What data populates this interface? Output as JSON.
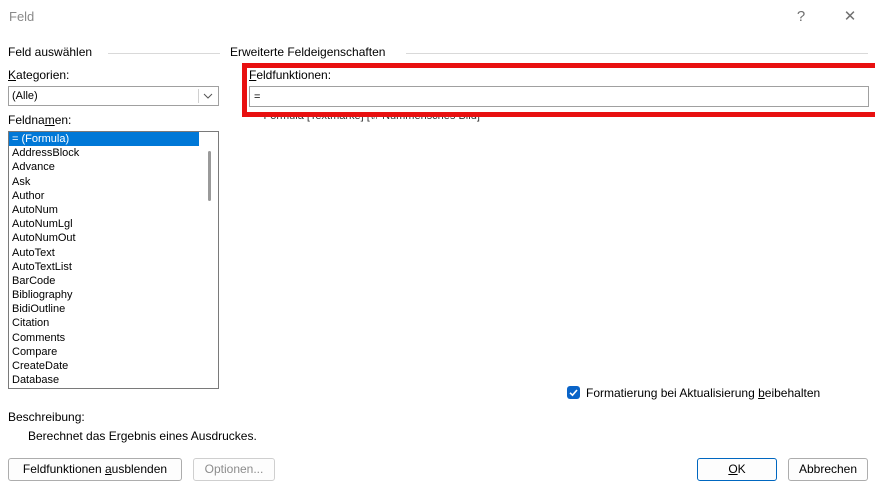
{
  "window": {
    "title": "Feld",
    "help_glyph": "?",
    "close_glyph": "✕"
  },
  "left": {
    "group_header": "Feld auswählen",
    "categories_label": "Kategorien:",
    "categories_value": "(Alle)",
    "fieldnames_label": "Feldnamen:",
    "fieldnames": [
      "= (Formula)",
      "AddressBlock",
      "Advance",
      "Ask",
      "Author",
      "AutoNum",
      "AutoNumLgl",
      "AutoNumOut",
      "AutoText",
      "AutoTextList",
      "BarCode",
      "Bibliography",
      "BidiOutline",
      "Citation",
      "Comments",
      "Compare",
      "CreateDate",
      "Database"
    ],
    "selected_index": 0
  },
  "right": {
    "group_header": "Erweiterte Feldeigenschaften",
    "field_codes_label": "Feldfunktionen:",
    "field_codes_value": "=",
    "syntax_hint": "= Formula [Textmarke] [\\# Nummerisches Bild]",
    "preserve_formatting_label": "Formatierung bei Aktualisierung beibehalten",
    "preserve_formatting_checked": true
  },
  "description": {
    "label": "Beschreibung:",
    "text": "Berechnet das Ergebnis eines Ausdruckes."
  },
  "buttons": {
    "hide_codes": "Feldfunktionen ausblenden",
    "options": "Optionen...",
    "ok": "OK",
    "cancel": "Abbrechen"
  },
  "colors": {
    "accent": "#0078d7",
    "highlight_box": "#e81010",
    "checkbox": "#0a64c8"
  }
}
